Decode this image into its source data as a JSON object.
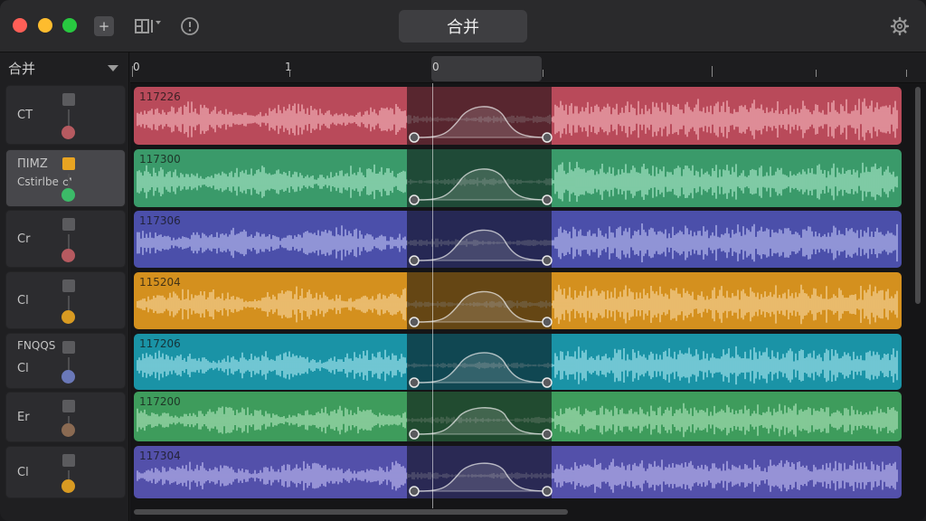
{
  "window": {
    "title": "合并"
  },
  "toolbar": {
    "add_label": "+",
    "layout_icon": "layout-icon",
    "info_icon": "info-icon",
    "settings_icon": "gear-icon"
  },
  "sidebar": {
    "header": "合并"
  },
  "ruler": {
    "labels": [
      "0",
      "1",
      "0"
    ]
  },
  "colors": {
    "red": "#b94a5a",
    "green": "#3a9a6a",
    "blue": "#4b4faa",
    "orange": "#d4901e",
    "teal": "#1a93a6",
    "green2": "#3e9c5c",
    "purple": "#5350aa"
  },
  "tracks": [
    {
      "name": "CT",
      "sub": "",
      "dot": "#b65a60",
      "square": "#5b5b5e",
      "clip_label": "117226",
      "color": "#b94a5a",
      "wave": "#f4b3bb",
      "selected": false
    },
    {
      "name": "ПIMZ",
      "sub": "Cstirlbe ♂",
      "dot": "#3cba68",
      "square": "#e8a422",
      "clip_label": "117300",
      "color": "#3a9a6a",
      "wave": "#a8e6c8",
      "selected": true
    },
    {
      "name": "Cr",
      "sub": "",
      "dot": "#b65a60",
      "square": "#5b5b5e",
      "clip_label": "117306",
      "color": "#4b4faa",
      "wave": "#b9bdf0",
      "selected": false
    },
    {
      "name": "Cl",
      "sub": "",
      "dot": "#d89a22",
      "square": "#5b5b5e",
      "clip_label": "115204",
      "color": "#d4901e",
      "wave": "#f6d49a",
      "selected": false
    },
    {
      "name": "Cl",
      "sub": "FNQQS",
      "dot": "#6a78b8",
      "square": "#5b5b5e",
      "clip_label": "117206",
      "color": "#1a93a6",
      "wave": "#a4e4ee",
      "selected": false
    },
    {
      "name": "Er",
      "sub": "",
      "dot": "#8a6a52",
      "square": "#5b5b5e",
      "clip_label": "117200",
      "color": "#3e9c5c",
      "wave": "#ace4b8",
      "selected": false
    },
    {
      "name": "Cl",
      "sub": "",
      "dot": "#d89a22",
      "square": "#5b5b5e",
      "clip_label": "117304",
      "color": "#5350aa",
      "wave": "#bdbaf0",
      "selected": false
    }
  ]
}
